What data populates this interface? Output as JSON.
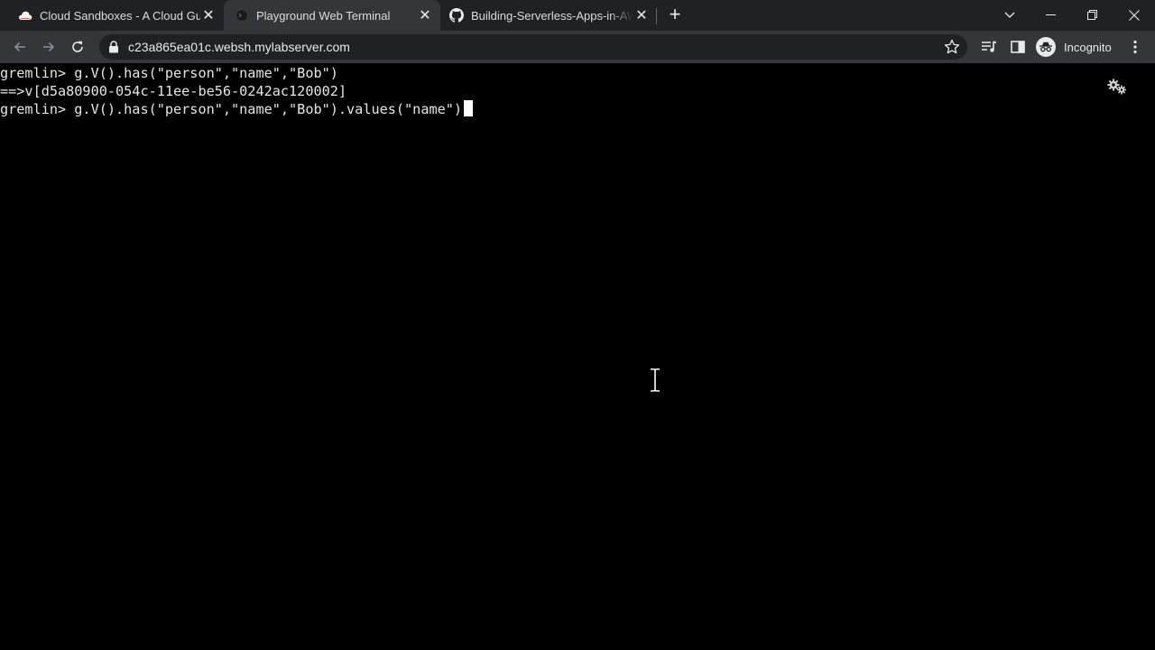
{
  "browser": {
    "tabs": [
      {
        "title": "Cloud Sandboxes - A Cloud Guru",
        "icon": "cloud-icon",
        "active": false
      },
      {
        "title": "Playground Web Terminal",
        "icon": "terminal-favicon-icon",
        "active": true
      },
      {
        "title": "Building-Serverless-Apps-in-AWS",
        "icon": "github-icon",
        "active": false
      }
    ],
    "address_bar": {
      "url": "c23a865ea01c.websh.mylabserver.com"
    },
    "profile_label": "Incognito",
    "colors": {
      "tabstrip": "#202124",
      "toolbar": "#35363a",
      "omnibox": "#202124",
      "text": "#e8eaed"
    }
  },
  "terminal": {
    "lines": [
      "gremlin> g.V().has(\"person\",\"name\",\"Bob\")",
      "==>v[d5a80900-054c-11ee-be56-0242ac120002]",
      "gremlin> g.V().has(\"person\",\"name\",\"Bob\").values(\"name\")"
    ],
    "colors": {
      "background": "#000000",
      "foreground": "#e6e6e6"
    }
  }
}
